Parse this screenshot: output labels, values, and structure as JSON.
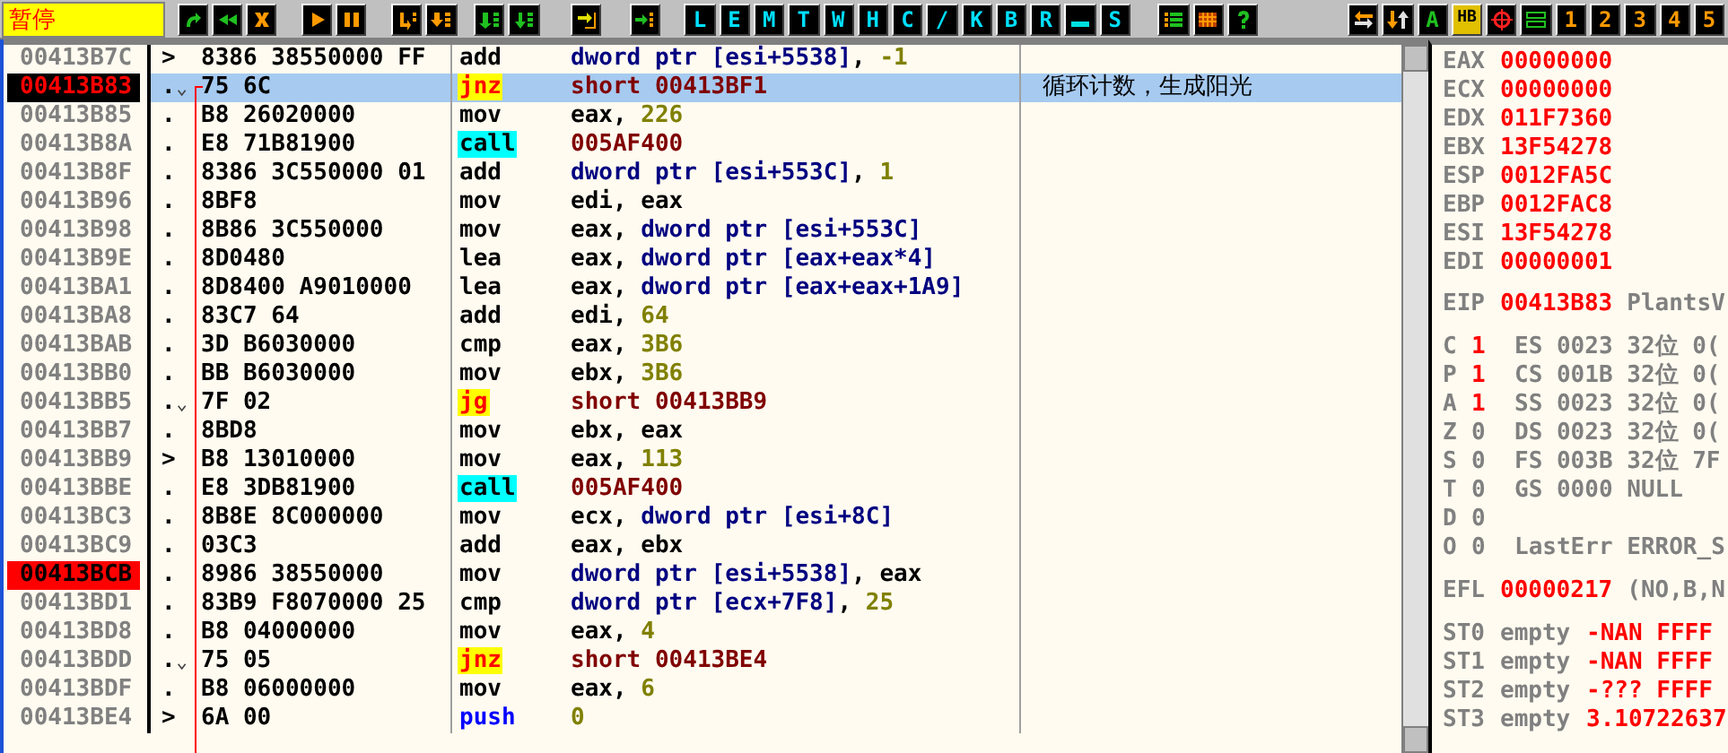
{
  "toolbar": {
    "status": "暂停",
    "letter_buttons": [
      "L",
      "E",
      "M",
      "T",
      "W",
      "H",
      "C",
      "/",
      "K",
      "B",
      "R",
      "S"
    ],
    "right_labels": [
      "A",
      "HB"
    ],
    "number_buttons": [
      "1",
      "2",
      "3",
      "4",
      "5"
    ]
  },
  "rows": [
    {
      "address": "00413B7C",
      "eip": false,
      "breakpoint": false,
      "marker": ">",
      "jump": false,
      "line_start": false,
      "selected": false,
      "hex": "8386 38550000 FF",
      "mnemonic": "add",
      "kind": "plain",
      "operands": [
        {
          "text": "dword ptr [esi+5538]",
          "kind": "mem"
        },
        {
          "text": ", ",
          "kind": "plain"
        },
        {
          "text": "-1",
          "kind": "const"
        }
      ]
    },
    {
      "address": "00413B83",
      "eip": true,
      "breakpoint": false,
      "marker": ".",
      "jump": true,
      "line_start": true,
      "selected": true,
      "hex": "75 6C",
      "mnemonic": "jnz",
      "kind": "jump",
      "operands": [
        {
          "text": "short 00413BF1",
          "kind": "target"
        }
      ],
      "comment": "循环计数，生成阳光"
    },
    {
      "address": "00413B85",
      "eip": false,
      "breakpoint": false,
      "marker": ".",
      "jump": false,
      "line_start": false,
      "selected": false,
      "hex": "B8 26020000",
      "mnemonic": "mov",
      "kind": "plain",
      "operands": [
        {
          "text": "eax, ",
          "kind": "plain"
        },
        {
          "text": "226",
          "kind": "const"
        }
      ]
    },
    {
      "address": "00413B8A",
      "eip": false,
      "breakpoint": false,
      "marker": ".",
      "jump": false,
      "line_start": false,
      "selected": false,
      "hex": "E8 71B81900",
      "mnemonic": "call",
      "kind": "call",
      "operands": [
        {
          "text": "005AF400",
          "kind": "target"
        }
      ]
    },
    {
      "address": "00413B8F",
      "eip": false,
      "breakpoint": false,
      "marker": ".",
      "jump": false,
      "line_start": false,
      "selected": false,
      "hex": "8386 3C550000 01",
      "mnemonic": "add",
      "kind": "plain",
      "operands": [
        {
          "text": "dword ptr [esi+553C]",
          "kind": "mem"
        },
        {
          "text": ", ",
          "kind": "plain"
        },
        {
          "text": "1",
          "kind": "const"
        }
      ]
    },
    {
      "address": "00413B96",
      "eip": false,
      "breakpoint": false,
      "marker": ".",
      "jump": false,
      "line_start": false,
      "selected": false,
      "hex": "8BF8",
      "mnemonic": "mov",
      "kind": "plain",
      "operands": [
        {
          "text": "edi, eax",
          "kind": "plain"
        }
      ]
    },
    {
      "address": "00413B98",
      "eip": false,
      "breakpoint": false,
      "marker": ".",
      "jump": false,
      "line_start": false,
      "selected": false,
      "hex": "8B86 3C550000",
      "mnemonic": "mov",
      "kind": "plain",
      "operands": [
        {
          "text": "eax, ",
          "kind": "plain"
        },
        {
          "text": "dword ptr [esi+553C]",
          "kind": "mem"
        }
      ]
    },
    {
      "address": "00413B9E",
      "eip": false,
      "breakpoint": false,
      "marker": ".",
      "jump": false,
      "line_start": false,
      "selected": false,
      "hex": "8D0480",
      "mnemonic": "lea",
      "kind": "plain",
      "operands": [
        {
          "text": "eax, ",
          "kind": "plain"
        },
        {
          "text": "dword ptr [eax+eax*4]",
          "kind": "mem"
        }
      ]
    },
    {
      "address": "00413BA1",
      "eip": false,
      "breakpoint": false,
      "marker": ".",
      "jump": false,
      "line_start": false,
      "selected": false,
      "hex": "8D8400 A9010000",
      "mnemonic": "lea",
      "kind": "plain",
      "operands": [
        {
          "text": "eax, ",
          "kind": "plain"
        },
        {
          "text": "dword ptr [eax+eax+1A9]",
          "kind": "mem"
        }
      ]
    },
    {
      "address": "00413BA8",
      "eip": false,
      "breakpoint": false,
      "marker": ".",
      "jump": false,
      "line_start": false,
      "selected": false,
      "hex": "83C7 64",
      "mnemonic": "add",
      "kind": "plain",
      "operands": [
        {
          "text": "edi, ",
          "kind": "plain"
        },
        {
          "text": "64",
          "kind": "const"
        }
      ]
    },
    {
      "address": "00413BAB",
      "eip": false,
      "breakpoint": false,
      "marker": ".",
      "jump": false,
      "line_start": false,
      "selected": false,
      "hex": "3D B6030000",
      "mnemonic": "cmp",
      "kind": "plain",
      "operands": [
        {
          "text": "eax, ",
          "kind": "plain"
        },
        {
          "text": "3B6",
          "kind": "const"
        }
      ]
    },
    {
      "address": "00413BB0",
      "eip": false,
      "breakpoint": false,
      "marker": ".",
      "jump": false,
      "line_start": false,
      "selected": false,
      "hex": "BB B6030000",
      "mnemonic": "mov",
      "kind": "plain",
      "operands": [
        {
          "text": "ebx, ",
          "kind": "plain"
        },
        {
          "text": "3B6",
          "kind": "const"
        }
      ]
    },
    {
      "address": "00413BB5",
      "eip": false,
      "breakpoint": false,
      "marker": ".",
      "jump": true,
      "line_start": false,
      "selected": false,
      "hex": "7F 02",
      "mnemonic": "jg",
      "kind": "jump",
      "operands": [
        {
          "text": "short 00413BB9",
          "kind": "target"
        }
      ]
    },
    {
      "address": "00413BB7",
      "eip": false,
      "breakpoint": false,
      "marker": ".",
      "jump": false,
      "line_start": false,
      "selected": false,
      "hex": "8BD8",
      "mnemonic": "mov",
      "kind": "plain",
      "operands": [
        {
          "text": "ebx, eax",
          "kind": "plain"
        }
      ]
    },
    {
      "address": "00413BB9",
      "eip": false,
      "breakpoint": false,
      "marker": ">",
      "jump": false,
      "line_start": false,
      "selected": false,
      "hex": "B8 13010000",
      "mnemonic": "mov",
      "kind": "plain",
      "operands": [
        {
          "text": "eax, ",
          "kind": "plain"
        },
        {
          "text": "113",
          "kind": "const"
        }
      ]
    },
    {
      "address": "00413BBE",
      "eip": false,
      "breakpoint": false,
      "marker": ".",
      "jump": false,
      "line_start": false,
      "selected": false,
      "hex": "E8 3DB81900",
      "mnemonic": "call",
      "kind": "call",
      "operands": [
        {
          "text": "005AF400",
          "kind": "target"
        }
      ]
    },
    {
      "address": "00413BC3",
      "eip": false,
      "breakpoint": false,
      "marker": ".",
      "jump": false,
      "line_start": false,
      "selected": false,
      "hex": "8B8E 8C000000",
      "mnemonic": "mov",
      "kind": "plain",
      "operands": [
        {
          "text": "ecx, ",
          "kind": "plain"
        },
        {
          "text": "dword ptr [esi+8C]",
          "kind": "mem"
        }
      ]
    },
    {
      "address": "00413BC9",
      "eip": false,
      "breakpoint": false,
      "marker": ".",
      "jump": false,
      "line_start": false,
      "selected": false,
      "hex": "03C3",
      "mnemonic": "add",
      "kind": "plain",
      "operands": [
        {
          "text": "eax, ebx",
          "kind": "plain"
        }
      ]
    },
    {
      "address": "00413BCB",
      "eip": false,
      "breakpoint": true,
      "marker": ".",
      "jump": false,
      "line_start": false,
      "selected": false,
      "hex": "8986 38550000",
      "mnemonic": "mov",
      "kind": "plain",
      "operands": [
        {
          "text": "dword ptr [esi+5538]",
          "kind": "mem"
        },
        {
          "text": ", eax",
          "kind": "plain"
        }
      ]
    },
    {
      "address": "00413BD1",
      "eip": false,
      "breakpoint": false,
      "marker": ".",
      "jump": false,
      "line_start": false,
      "selected": false,
      "hex": "83B9 F8070000 25",
      "mnemonic": "cmp",
      "kind": "plain",
      "operands": [
        {
          "text": "dword ptr [ecx+7F8]",
          "kind": "mem"
        },
        {
          "text": ", ",
          "kind": "plain"
        },
        {
          "text": "25",
          "kind": "const"
        }
      ]
    },
    {
      "address": "00413BD8",
      "eip": false,
      "breakpoint": false,
      "marker": ".",
      "jump": false,
      "line_start": false,
      "selected": false,
      "hex": "B8 04000000",
      "mnemonic": "mov",
      "kind": "plain",
      "operands": [
        {
          "text": "eax, ",
          "kind": "plain"
        },
        {
          "text": "4",
          "kind": "const"
        }
      ]
    },
    {
      "address": "00413BDD",
      "eip": false,
      "breakpoint": false,
      "marker": ".",
      "jump": true,
      "line_start": false,
      "selected": false,
      "hex": "75 05",
      "mnemonic": "jnz",
      "kind": "jump",
      "operands": [
        {
          "text": "short 00413BE4",
          "kind": "target"
        }
      ]
    },
    {
      "address": "00413BDF",
      "eip": false,
      "breakpoint": false,
      "marker": ".",
      "jump": false,
      "line_start": false,
      "selected": false,
      "hex": "B8 06000000",
      "mnemonic": "mov",
      "kind": "plain",
      "operands": [
        {
          "text": "eax, ",
          "kind": "plain"
        },
        {
          "text": "6",
          "kind": "const"
        }
      ]
    },
    {
      "address": "00413BE4",
      "eip": false,
      "breakpoint": false,
      "marker": ">",
      "jump": false,
      "line_start": false,
      "selected": false,
      "hex": "6A 00",
      "mnemonic": "push",
      "kind": "push",
      "operands": [
        {
          "text": "0",
          "kind": "const"
        }
      ]
    }
  ],
  "registers": [
    {
      "name": "EAX",
      "value": "00000000",
      "changed": true
    },
    {
      "name": "ECX",
      "value": "00000000",
      "changed": true
    },
    {
      "name": "EDX",
      "value": "011F7360",
      "changed": true
    },
    {
      "name": "EBX",
      "value": "13F54278",
      "changed": true
    },
    {
      "name": "ESP",
      "value": "0012FA5C",
      "changed": true
    },
    {
      "name": "EBP",
      "value": "0012FAC8",
      "changed": true
    },
    {
      "name": "ESI",
      "value": "13F54278",
      "changed": true
    },
    {
      "name": "EDI",
      "value": "00000001",
      "changed": true
    }
  ],
  "eip": {
    "name": "EIP",
    "value": "00413B83",
    "changed": true,
    "info": "PlantsV"
  },
  "flags": [
    {
      "name": "C",
      "value": "1",
      "changed": true,
      "segment": "ES 0023 32位 0("
    },
    {
      "name": "P",
      "value": "1",
      "changed": true,
      "segment": "CS 001B 32位 0("
    },
    {
      "name": "A",
      "value": "1",
      "changed": true,
      "segment": "SS 0023 32位 0("
    },
    {
      "name": "Z",
      "value": "0",
      "changed": false,
      "segment": "DS 0023 32位 0("
    },
    {
      "name": "S",
      "value": "0",
      "changed": false,
      "segment": "FS 003B 32位 7F"
    },
    {
      "name": "T",
      "value": "0",
      "changed": false,
      "segment": "GS 0000 NULL"
    },
    {
      "name": "D",
      "value": "0",
      "changed": false
    },
    {
      "name": "O",
      "value": "0",
      "changed": false,
      "segment": "LastErr ERROR_S"
    }
  ],
  "efl": {
    "name": "EFL",
    "value": "00000217",
    "changed": true,
    "info": "(NO,B,N"
  },
  "fpu": [
    {
      "name": "ST0",
      "tag": "empty",
      "value": "-NAN FFFF",
      "changed": true
    },
    {
      "name": "ST1",
      "tag": "empty",
      "value": "-NAN FFFF",
      "changed": true
    },
    {
      "name": "ST2",
      "tag": "empty",
      "value": "-??? FFFF",
      "changed": true
    },
    {
      "name": "ST3",
      "tag": "empty",
      "value": "3.10722637",
      "changed": true
    }
  ]
}
